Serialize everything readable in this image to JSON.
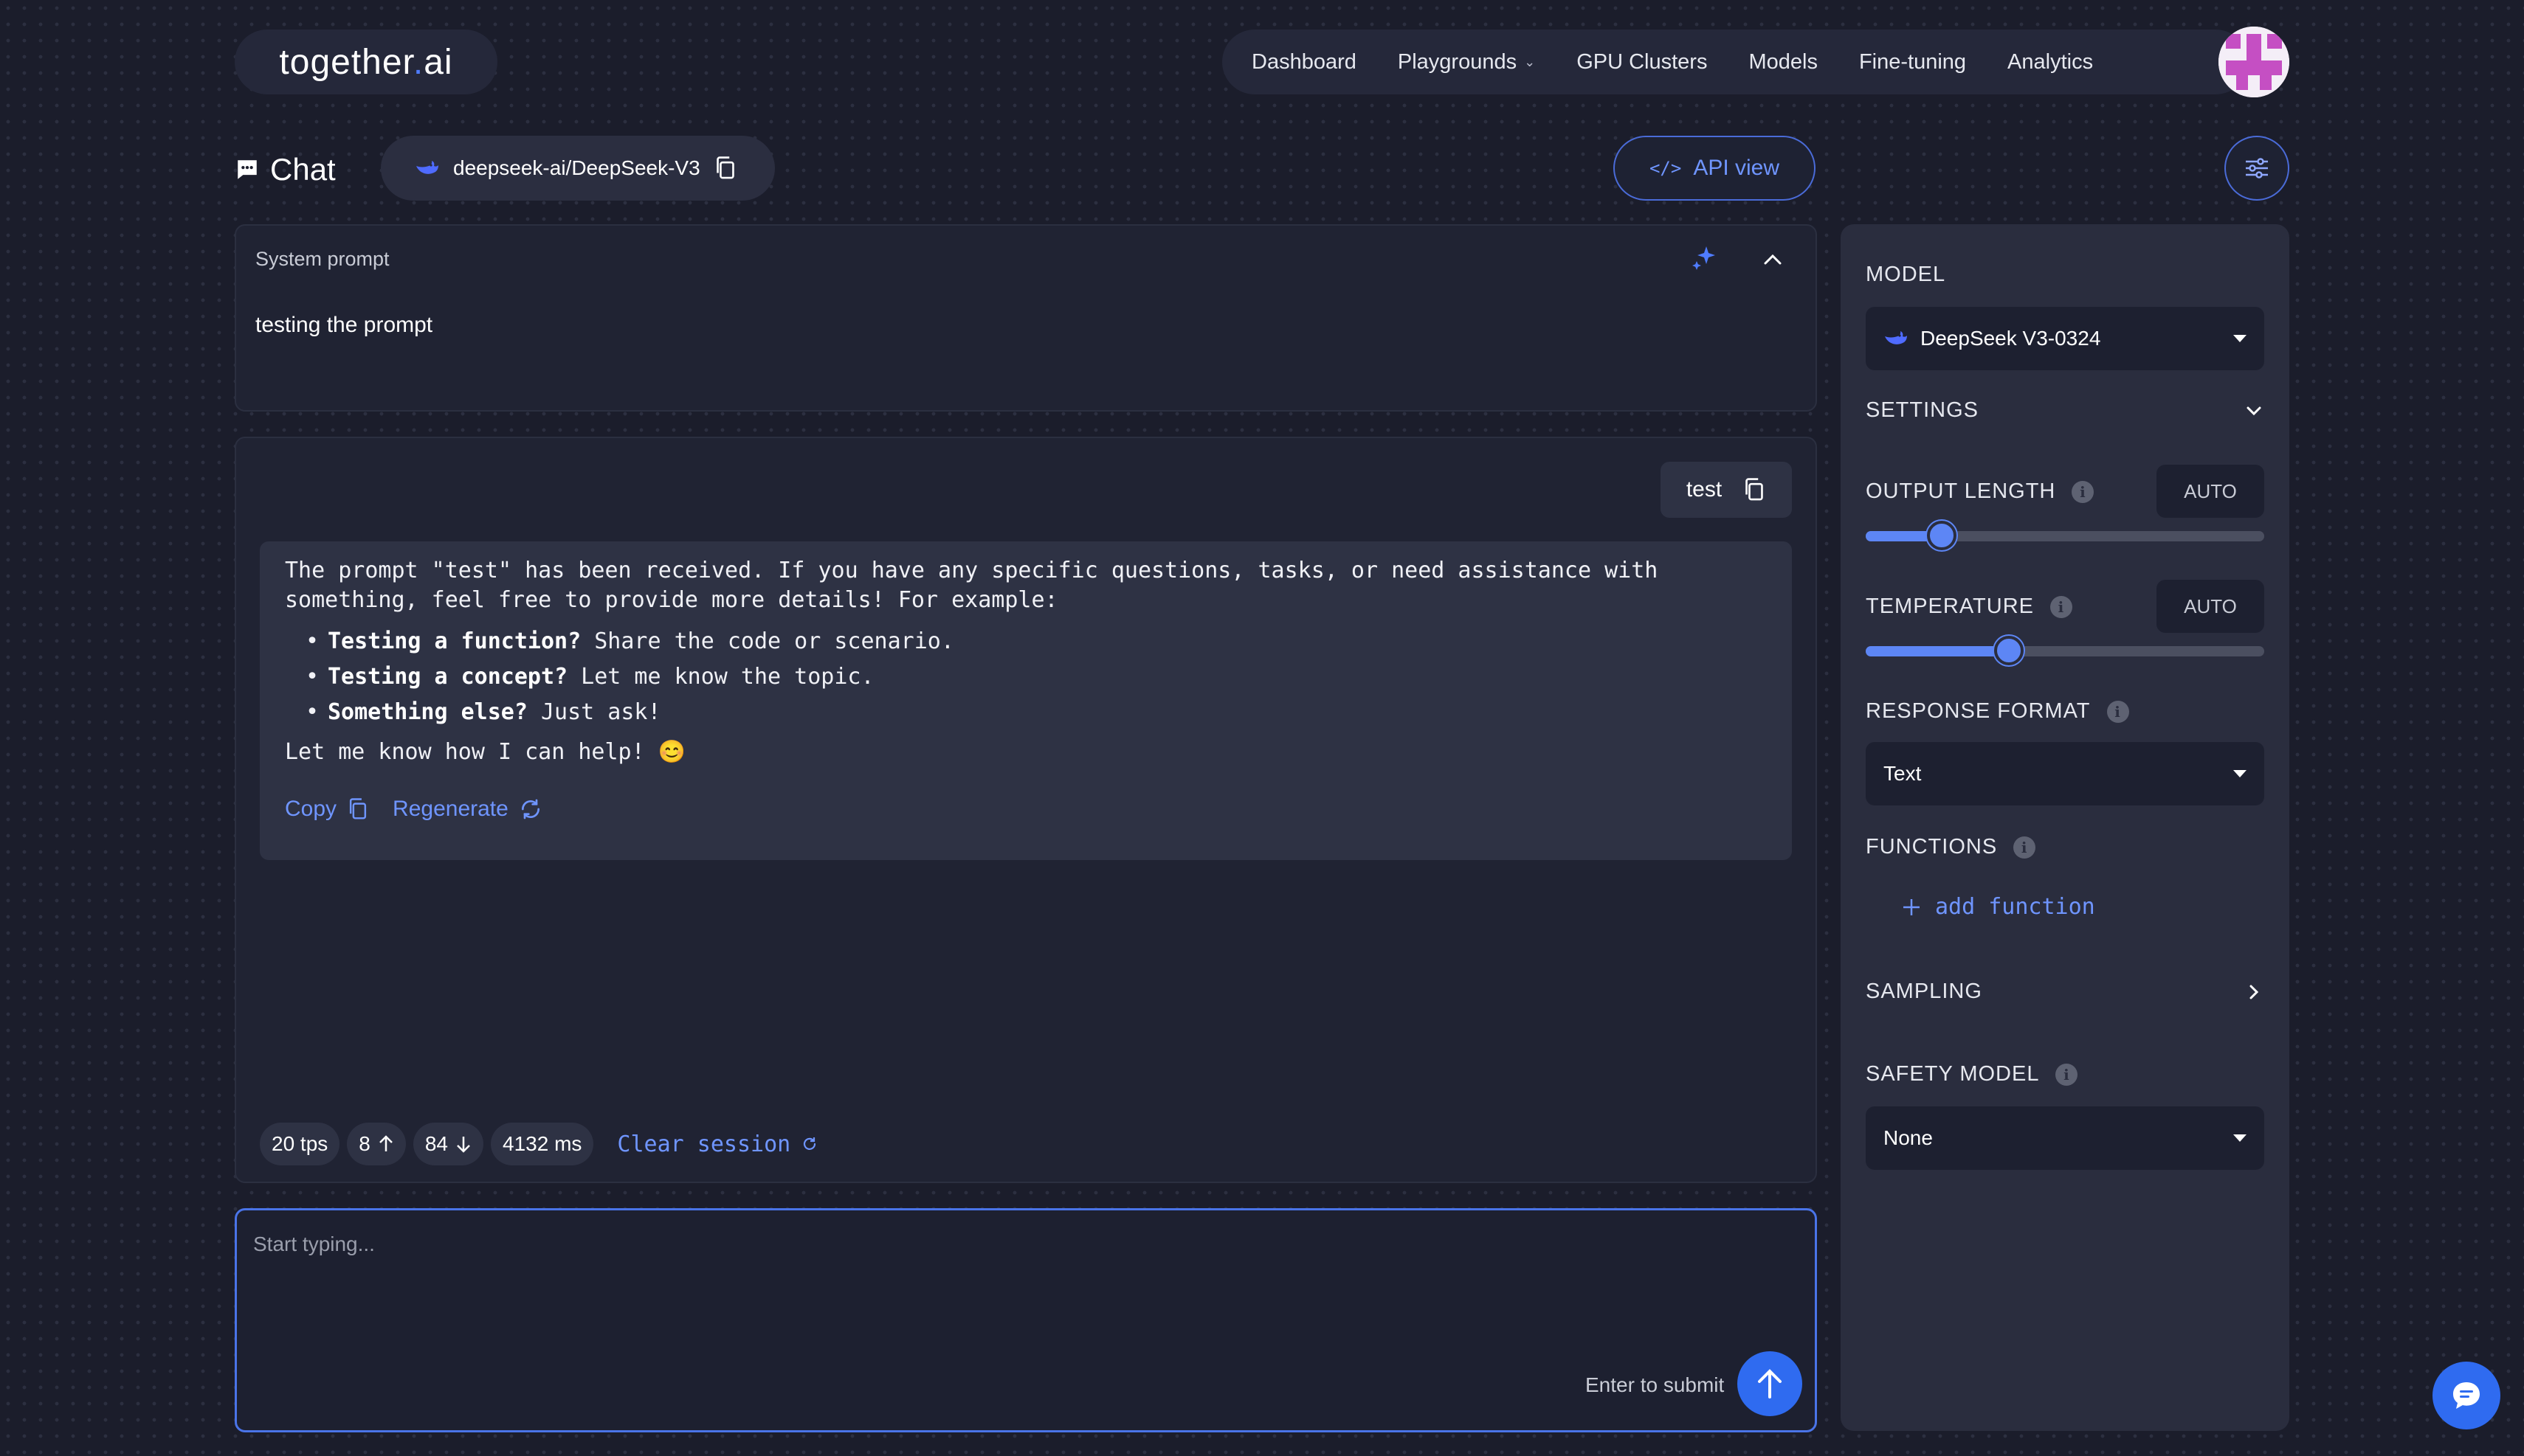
{
  "brand": {
    "name_before": "together",
    "name_dot": ".",
    "name_after": "ai"
  },
  "nav": {
    "items": [
      "Dashboard",
      "Playgrounds",
      "GPU Clusters",
      "Models",
      "Fine-tuning",
      "Analytics"
    ]
  },
  "chat": {
    "title": "Chat",
    "model_id": "deepseek-ai/DeepSeek-V3",
    "api_view_label": "API view"
  },
  "system_prompt": {
    "label": "System prompt",
    "text": "testing the prompt"
  },
  "conversation": {
    "user_message": "test",
    "assistant": {
      "intro": "The prompt \"test\" has been received. If you have any specific questions, tasks, or need assistance with something, feel free to provide more details! For example:",
      "bullets": [
        {
          "bold": "Testing a function?",
          "rest": " Share the code or scenario."
        },
        {
          "bold": "Testing a concept?",
          "rest": " Let me know the topic."
        },
        {
          "bold": "Something else?",
          "rest": " Just ask!"
        }
      ],
      "closing": "Let me know how I can help! 😊"
    },
    "copy_label": "Copy",
    "regenerate_label": "Regenerate"
  },
  "stats": {
    "tps": "20 tps",
    "tokens_up": "8",
    "tokens_down": "84",
    "latency": "4132 ms",
    "clear_label": "Clear session"
  },
  "composer": {
    "placeholder": "Start typing...",
    "hint": "Enter to submit"
  },
  "settings_panel": {
    "model_label": "MODEL",
    "model_value": "DeepSeek V3-0324",
    "settings_label": "SETTINGS",
    "output_length_label": "OUTPUT LENGTH",
    "output_length_value": "AUTO",
    "output_length_level": 0.19,
    "temperature_label": "TEMPERATURE",
    "temperature_value": "AUTO",
    "temperature_level": 0.36,
    "response_format_label": "RESPONSE FORMAT",
    "response_format_value": "Text",
    "functions_label": "FUNCTIONS",
    "add_function_label": "add function",
    "sampling_label": "SAMPLING",
    "safety_model_label": "SAFETY MODEL",
    "safety_model_value": "None"
  },
  "colors": {
    "accent": "#4f7cff",
    "link": "#6f95ff",
    "background": "#1b1d2b",
    "panel": "#202333"
  }
}
